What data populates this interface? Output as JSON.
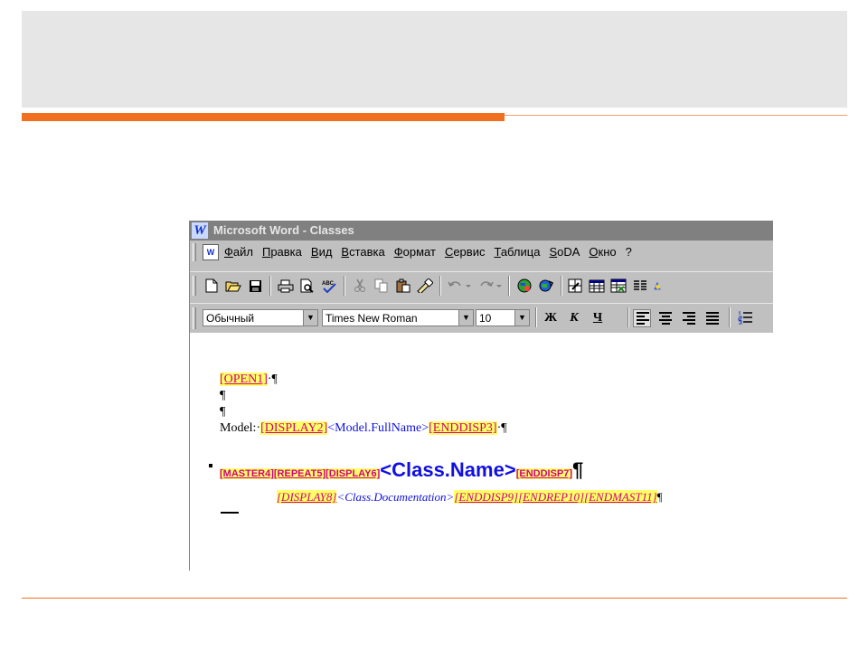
{
  "window": {
    "title": "Microsoft Word - Classes",
    "app_icon": "W"
  },
  "menu": {
    "doc_icon": "W",
    "items": [
      "Файл",
      "Правка",
      "Вид",
      "Вставка",
      "Формат",
      "Сервис",
      "Таблица",
      "SoDA",
      "Окно",
      "?"
    ]
  },
  "toolbar": {
    "icons": [
      "new-document-icon",
      "open-folder-icon",
      "save-icon",
      "print-icon",
      "print-preview-icon",
      "spelling-icon",
      "cut-icon",
      "copy-icon",
      "paste-icon",
      "format-painter-icon",
      "undo-icon",
      "redo-icon",
      "web-icon",
      "hyperlink-icon",
      "tables-borders-icon",
      "insert-table-icon",
      "insert-excel-icon",
      "columns-icon",
      "drawing-icon"
    ]
  },
  "format": {
    "style": "Обычный",
    "font": "Times New Roman",
    "size": "10",
    "bold": "Ж",
    "italic": "К",
    "underline": "Ч"
  },
  "document": {
    "line1": {
      "tag": "[OPEN1]",
      "mark": "·¶"
    },
    "line2": "¶",
    "line3": "¶",
    "line4": {
      "prefix": "Model:·",
      "tag1": "[DISPLAY2]",
      "field": "<Model.FullName>",
      "tag2": "[ENDDISP3]",
      "mark": "·¶"
    },
    "line5": {
      "tags": "[MASTER4][REPEAT5][DISPLAY6]",
      "field": "<Class.Name>",
      "tag2": "[ENDDISP7]",
      "mark": "¶"
    },
    "line6": {
      "tag1": "[DISPLAY8]",
      "field": "<Class.Documentation>",
      "tags2": "[ENDDISP9][ENDREP10][ENDMAST11]",
      "mark": "¶"
    }
  }
}
